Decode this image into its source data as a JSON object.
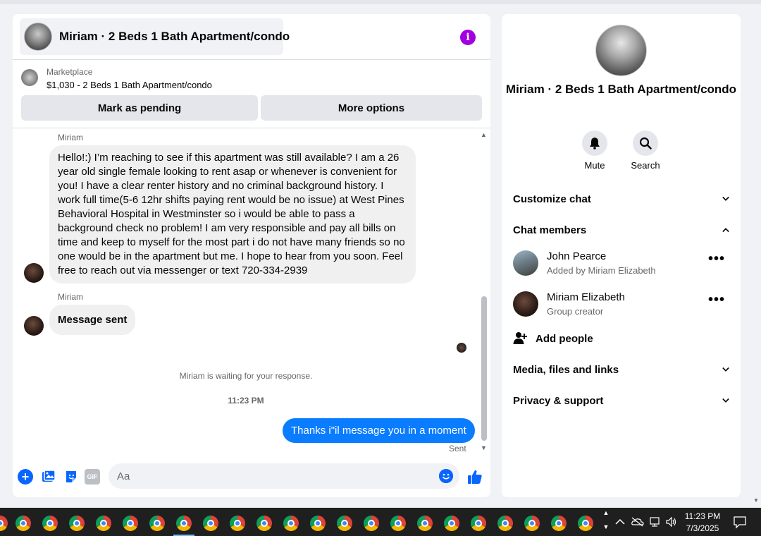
{
  "chat": {
    "title": "Miriam · 2 Beds 1 Bath Apartment/condo",
    "marketplace_label": "Marketplace",
    "listing": "$1,030 - 2 Beds 1 Bath Apartment/condo",
    "mark_pending_label": "Mark as pending",
    "more_options_label": "More options",
    "messages": [
      {
        "sender": "Miriam",
        "text": "Hello!:) I’m reaching to see if this apartment was still available? I am a 26 year old single female looking to rent asap or whenever  is convenient  for you! I have a clear renter history and no criminal background history. I work full time(5-6 12hr shifts paying rent would be no issue) at West Pines Behavioral Hospital in Westminster so i would be able to pass a background check no problem! I am very responsible and pay all bills on time and keep to myself for the most part i do not have many friends so no one would be in the apartment but me. I hope to hear from you soon. Feel free to reach out via messenger or text 720-334-2939"
      },
      {
        "sender": "Miriam",
        "text": "Message sent"
      }
    ],
    "waiting_text": "Miriam is waiting for your response.",
    "timestamp": "11:23 PM",
    "outgoing_text": "Thanks i\"il message you in a moment",
    "sent_label": "Sent",
    "composer_placeholder": "Aa",
    "gif_label": "GIF"
  },
  "info": {
    "title": "Miriam · 2 Beds 1 Bath Apartment/condo",
    "mute_label": "Mute",
    "search_label": "Search",
    "customize_label": "Customize chat",
    "members_label": "Chat members",
    "members": [
      {
        "name": "John Pearce",
        "sub": "Added by Miriam Elizabeth"
      },
      {
        "name": "Miriam Elizabeth",
        "sub": "Group creator"
      }
    ],
    "add_people_label": "Add people",
    "media_label": "Media, files and links",
    "privacy_label": "Privacy & support"
  },
  "taskbar": {
    "time": "11:23 PM",
    "date": "7/3/2025"
  },
  "colors": {
    "accent": "#0866ff",
    "outgoing_bubble": "#0a7cff",
    "info_icon": "#a200e0"
  }
}
